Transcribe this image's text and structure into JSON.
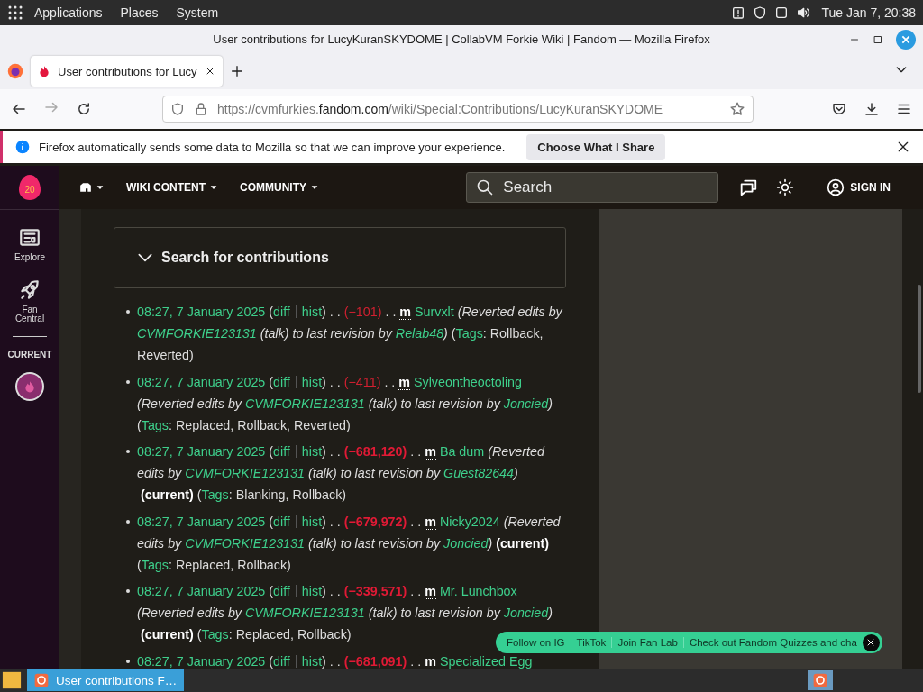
{
  "top_panel": {
    "menus": [
      "Applications",
      "Places",
      "System"
    ],
    "clock": "Tue Jan 7, 20:38"
  },
  "window": {
    "title": "User contributions for LucyKuranSKYDOME | CollabVM Forkie Wiki | Fandom — Mozilla Firefox"
  },
  "tabs": [
    {
      "label": "User contributions for Lucy",
      "selected": true
    }
  ],
  "url": {
    "prefix": "https://cvmfurkies.",
    "domain": "fandom.com",
    "path": "/wiki/Special:Contributions/LucyKuranSKYDOME"
  },
  "notification": {
    "message": "Firefox automatically sends some data to Mozilla so that we can improve your experience.",
    "button": "Choose What I Share"
  },
  "rail": {
    "logo": "20",
    "items": [
      {
        "label": "Explore",
        "kind": "explore"
      },
      {
        "label": "Fan Central",
        "kind": "rocket"
      }
    ],
    "section": "CURRENT"
  },
  "nav": {
    "items": [
      "WIKI CONTENT",
      "COMMUNITY"
    ],
    "search_placeholder": "Search",
    "sign_in": "SIGN IN"
  },
  "search_panel": {
    "title": "Search for contributions",
    "expanded": false
  },
  "contributions": [
    {
      "segments": [
        {
          "kind": "link",
          "text": "08:27, 7 January 2025"
        },
        {
          "kind": "text",
          "text": " ("
        },
        {
          "kind": "link",
          "text": "diff"
        },
        {
          "kind": "divider"
        },
        {
          "kind": "link",
          "text": "hist"
        },
        {
          "kind": "text",
          "text": ") . . "
        },
        {
          "kind": "size",
          "text": "(−101)"
        },
        {
          "kind": "text",
          "text": " . . "
        },
        {
          "kind": "minor",
          "text": "m"
        },
        {
          "kind": "link",
          "text": "Survxlt"
        },
        {
          "kind": "italic",
          "text": " (Reverted edits by "
        },
        {
          "kind": "ilink",
          "text": "CVMFORKIE123131"
        },
        {
          "kind": "italic",
          "text": " (talk) to last revision by "
        },
        {
          "kind": "ilink",
          "text": "Relab48"
        },
        {
          "kind": "italic",
          "text": ")"
        },
        {
          "kind": "text",
          "text": " ("
        },
        {
          "kind": "link",
          "text": "Tags"
        },
        {
          "kind": "text",
          "text": ": Rollback, Reverted)"
        }
      ]
    },
    {
      "segments": [
        {
          "kind": "link",
          "text": "08:27, 7 January 2025"
        },
        {
          "kind": "text",
          "text": " ("
        },
        {
          "kind": "link",
          "text": "diff"
        },
        {
          "kind": "divider"
        },
        {
          "kind": "link",
          "text": "hist"
        },
        {
          "kind": "text",
          "text": ") . . "
        },
        {
          "kind": "size",
          "text": "(−411)"
        },
        {
          "kind": "text",
          "text": " . . "
        },
        {
          "kind": "minor",
          "text": "m"
        },
        {
          "kind": "link",
          "text": "Sylveontheoctoling"
        },
        {
          "kind": "italic",
          "text": " (Reverted edits by "
        },
        {
          "kind": "ilink",
          "text": "CVMFORKIE123131"
        },
        {
          "kind": "italic",
          "text": " (talk) to last revision by "
        },
        {
          "kind": "ilink",
          "text": "Joncied"
        },
        {
          "kind": "italic",
          "text": ")"
        },
        {
          "kind": "text",
          "text": " ("
        },
        {
          "kind": "link",
          "text": "Tags"
        },
        {
          "kind": "text",
          "text": ": Replaced, Rollback, Reverted)"
        }
      ]
    },
    {
      "segments": [
        {
          "kind": "link",
          "text": "08:27, 7 January 2025"
        },
        {
          "kind": "text",
          "text": " ("
        },
        {
          "kind": "link",
          "text": "diff"
        },
        {
          "kind": "divider"
        },
        {
          "kind": "link",
          "text": "hist"
        },
        {
          "kind": "text",
          "text": ") . . "
        },
        {
          "kind": "bigsize",
          "text": "(−681,120)"
        },
        {
          "kind": "text",
          "text": " . . "
        },
        {
          "kind": "minor",
          "text": "m"
        },
        {
          "kind": "link",
          "text": "Ba dum"
        },
        {
          "kind": "italic",
          "text": " (Reverted edits by "
        },
        {
          "kind": "ilink",
          "text": "CVMFORKIE123131"
        },
        {
          "kind": "italic",
          "text": " (talk) to last revision by "
        },
        {
          "kind": "ilink",
          "text": "Guest82644"
        },
        {
          "kind": "italic",
          "text": ")"
        },
        {
          "kind": "bold",
          "text": "(current)"
        },
        {
          "kind": "text",
          "text": " ("
        },
        {
          "kind": "link",
          "text": "Tags"
        },
        {
          "kind": "text",
          "text": ": Blanking, Rollback)"
        }
      ]
    },
    {
      "segments": [
        {
          "kind": "link",
          "text": "08:27, 7 January 2025"
        },
        {
          "kind": "text",
          "text": " ("
        },
        {
          "kind": "link",
          "text": "diff"
        },
        {
          "kind": "divider"
        },
        {
          "kind": "link",
          "text": "hist"
        },
        {
          "kind": "text",
          "text": ") . . "
        },
        {
          "kind": "bigsize",
          "text": "(−679,972)"
        },
        {
          "kind": "text",
          "text": " . . "
        },
        {
          "kind": "minor",
          "text": "m"
        },
        {
          "kind": "link",
          "text": "Nicky2024"
        },
        {
          "kind": "italic",
          "text": " (Reverted edits by "
        },
        {
          "kind": "ilink",
          "text": "CVMFORKIE123131"
        },
        {
          "kind": "italic",
          "text": " (talk) to last revision by "
        },
        {
          "kind": "ilink",
          "text": "Joncied"
        },
        {
          "kind": "italic",
          "text": ")"
        },
        {
          "kind": "bold",
          "text": "(current)"
        },
        {
          "kind": "text",
          "text": " ("
        },
        {
          "kind": "link",
          "text": "Tags"
        },
        {
          "kind": "text",
          "text": ": Replaced, Rollback)"
        }
      ]
    },
    {
      "segments": [
        {
          "kind": "link",
          "text": "08:27, 7 January 2025"
        },
        {
          "kind": "text",
          "text": " ("
        },
        {
          "kind": "link",
          "text": "diff"
        },
        {
          "kind": "divider"
        },
        {
          "kind": "link",
          "text": "hist"
        },
        {
          "kind": "text",
          "text": ") . . "
        },
        {
          "kind": "bigsize",
          "text": "(−339,571)"
        },
        {
          "kind": "text",
          "text": " . . "
        },
        {
          "kind": "minor",
          "text": "m"
        },
        {
          "kind": "link",
          "text": "Mr. Lunchbox"
        },
        {
          "kind": "italic",
          "text": " (Reverted edits by "
        },
        {
          "kind": "ilink",
          "text": "CVMFORKIE123131"
        },
        {
          "kind": "italic",
          "text": " (talk) to last revision by "
        },
        {
          "kind": "ilink",
          "text": "Joncied"
        },
        {
          "kind": "italic",
          "text": ")"
        },
        {
          "kind": "bold",
          "text": "(current)"
        },
        {
          "kind": "text",
          "text": " ("
        },
        {
          "kind": "link",
          "text": "Tags"
        },
        {
          "kind": "text",
          "text": ": Replaced, Rollback)"
        }
      ]
    },
    {
      "segments": [
        {
          "kind": "link",
          "text": "08:27, 7 January 2025"
        },
        {
          "kind": "text",
          "text": " ("
        },
        {
          "kind": "link",
          "text": "diff"
        },
        {
          "kind": "divider"
        },
        {
          "kind": "link",
          "text": "hist"
        },
        {
          "kind": "text",
          "text": ") . . "
        },
        {
          "kind": "bigsize",
          "text": "(−681,091)"
        },
        {
          "kind": "text",
          "text": " . . "
        },
        {
          "kind": "minor",
          "text": "m"
        },
        {
          "kind": "link",
          "text": "Specialized Egg"
        }
      ]
    }
  ],
  "promo": {
    "links": [
      "Follow on IG",
      "TikTok",
      "Join Fan Lab",
      "Check out Fandom Quizzes and cha"
    ]
  },
  "taskbar": {
    "windows": [
      {
        "label": "User contributions F…",
        "selected": true
      }
    ]
  }
}
